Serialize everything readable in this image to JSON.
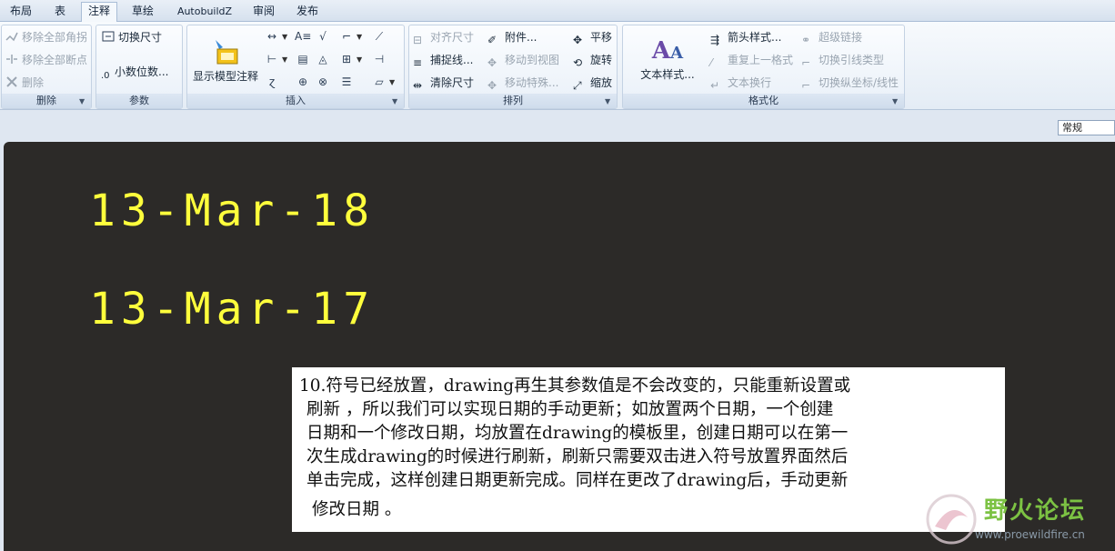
{
  "tabs": [
    "布局",
    "表",
    "注释",
    "草绘",
    "AutobuildZ",
    "审阅",
    "发布"
  ],
  "active_tab": "注释",
  "ribbon": {
    "delete_group": {
      "label": "删除",
      "items": [
        "移除全部角拐",
        "移除全部断点",
        "删除"
      ]
    },
    "params_group": {
      "label": "参数",
      "items": [
        "切换尺寸",
        "小数位数..."
      ]
    },
    "insert_group": {
      "label": "插入",
      "big_button": "显示模型注释"
    },
    "arrange_group": {
      "label": "排列",
      "items": [
        "对齐尺寸",
        "捕捉线...",
        "清除尺寸",
        "附件...",
        "移动到视图",
        "移动特殊...",
        "平移",
        "旋转",
        "缩放"
      ]
    },
    "format_group": {
      "label": "格式化",
      "big_button": "文本样式...",
      "items": [
        "箭头样式...",
        "重复上一格式",
        "文本换行",
        "超级链接",
        "切换引线类型",
        "切换纵坐标/线性"
      ]
    }
  },
  "combo": {
    "value": "常规"
  },
  "drawing": {
    "dates": [
      "13-Mar-18",
      "13-Mar-17"
    ],
    "note_lines": [
      "10.符号已经放置，drawing再生其参数值是不会改变的，只能重新设置或",
      "刷新 ，所以我们可以实现日期的手动更新；如放置两个日期，一个创建",
      "日期和一个修改日期，均放置在drawing的模板里，创建日期可以在第一",
      "次生成drawing的时候进行刷新，刷新只需要双击进入符号放置界面然后",
      "单击完成，这样创建日期更新完成。同样在更改了drawing后，手动更新",
      "修改日期 。"
    ]
  },
  "watermark": {
    "title": "野火论坛",
    "url": "www.proewildfire.cn"
  },
  "colors": {
    "canvas": "#2c2a28",
    "date_text": "#ffff3c",
    "watermark_green": "#7cc243"
  }
}
